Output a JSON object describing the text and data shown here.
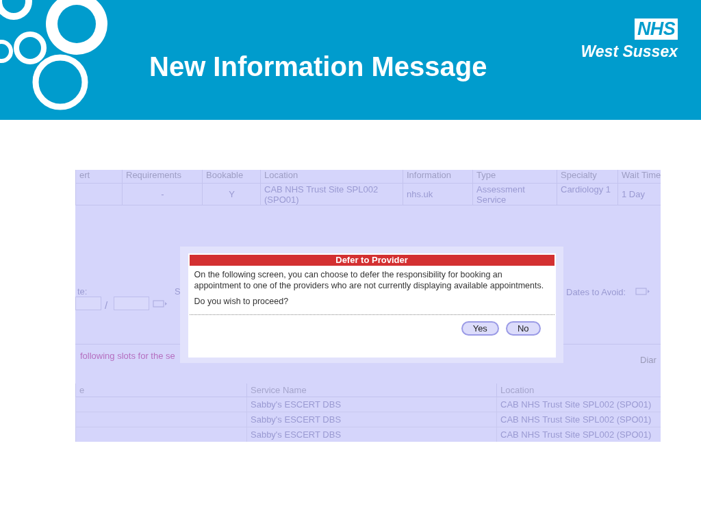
{
  "slide": {
    "title": "New Information Message",
    "logo": {
      "mark": "NHS",
      "name": "West Sussex"
    }
  },
  "screenshot": {
    "top_table": {
      "columns": [
        "ert",
        "Requirements",
        "Bookable",
        "Location",
        "Information",
        "Type",
        "Specialty",
        "Wait Time"
      ],
      "rows": [
        [
          "",
          "-",
          "Y",
          "CAB NHS Trust Site SPL002 (SPO01)",
          "nhs.uk",
          "Assessment Service",
          "Cardiology 1",
          "1  Day"
        ]
      ]
    },
    "form": {
      "date_label": "te:",
      "separator": "/",
      "letters": [
        "S"
      ],
      "avoid_label": "Dates to Avoid:"
    },
    "slots_note": "following slots for the se",
    "diary_label": "Diar",
    "bottom_table": {
      "columns": [
        "e",
        "Service Name",
        "Location"
      ],
      "rows": [
        [
          "",
          "Sabby's ESCERT DBS",
          "CAB NHS Trust Site SPL002 (SPO01)"
        ],
        [
          "",
          "Sabby's ESCERT DBS",
          "CAB NHS Trust Site SPL002 (SPO01)"
        ],
        [
          "",
          "Sabby's ESCERT DBS",
          "CAB NHS Trust Site SPL002 (SPO01)"
        ]
      ]
    },
    "dialog": {
      "title": "Defer to Provider",
      "message": "On the following screen, you can choose to defer the responsibility for booking an appointment to one of the providers who are not currently displaying available appointments.",
      "question": "Do you wish to proceed?",
      "buttons": [
        "Yes",
        "No"
      ]
    }
  }
}
